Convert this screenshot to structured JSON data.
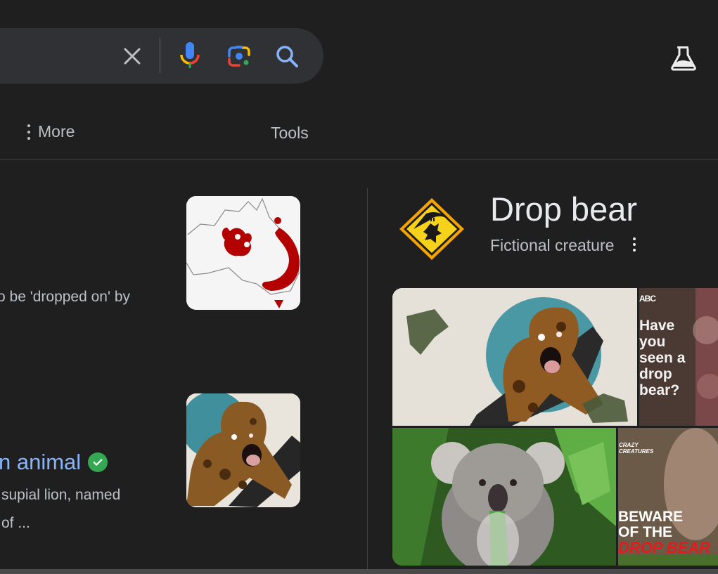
{
  "search": {
    "clear_icon": "close-icon",
    "voice_icon": "microphone-icon",
    "lens_icon": "camera-lens-icon",
    "search_icon": "search-icon"
  },
  "header": {
    "labs_icon": "flask-icon"
  },
  "nav": {
    "more_label": "More",
    "tools_label": "Tools"
  },
  "results": [
    {
      "snippet": "o be 'dropped on' by",
      "thumbnail": "australia-map-red-regions"
    },
    {
      "title": "n animal",
      "verified_icon": "verified-check-icon",
      "snippet_lines": [
        "supial lion, named",
        "of ..."
      ],
      "thumbnail": "drop-bear-illustration"
    }
  ],
  "knowledge_panel": {
    "title": "Drop bear",
    "subtitle": "Fictional creature",
    "logo": "drop-bear-warning-sign",
    "gallery": [
      {
        "alt": "drop-bear-illustration"
      },
      {
        "logo_text": "ABC",
        "overlay_text": "Have\nyou\nseen a\ndrop\nbear?"
      },
      {
        "alt": "koala-eating-leaf"
      },
      {
        "tag_text": "CRAZY\nCREATURES",
        "headline": "BEWARE\nOF THE",
        "headline_red": "DROP BEAR"
      }
    ]
  }
}
